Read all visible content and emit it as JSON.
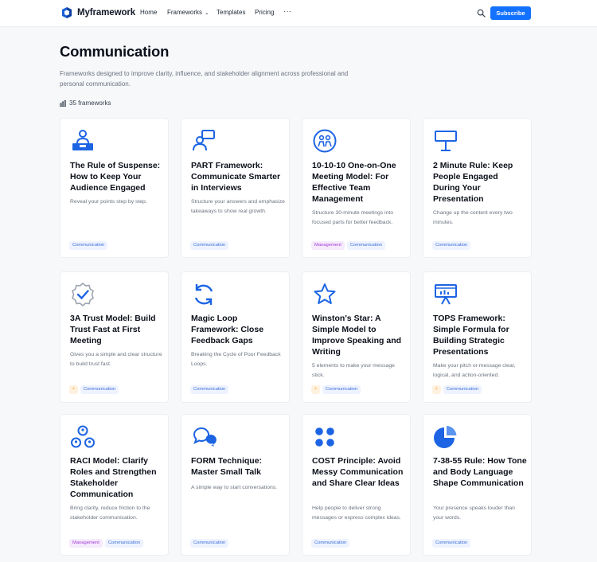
{
  "header": {
    "brand": "Myframework",
    "nav": [
      {
        "label": "Home"
      },
      {
        "label": "Frameworks",
        "has_dropdown": true
      },
      {
        "label": "Templates"
      },
      {
        "label": "Pricing"
      }
    ],
    "more": "···",
    "subscribe_label": "Subscribe",
    "accent_color": "#1371ff"
  },
  "page": {
    "title": "Communication",
    "description": "Frameworks designed to improve clarity, influence, and stakeholder alignment across professional and personal communication.",
    "count_label": "35 frameworks"
  },
  "cards": [
    {
      "icon": "presenter-at-podium-icon",
      "title": "The Rule of Suspense: How to Keep Your Audience Engaged",
      "description": "Reveal your points step by step.",
      "tags": [
        "Communication"
      ],
      "featured": false
    },
    {
      "icon": "interview-person-speech-icon",
      "title": "PART Framework: Communicate Smarter in Interviews",
      "description": "Structure your answers and emphasize takeaways to show real growth.",
      "tags": [
        "Communication"
      ],
      "featured": false
    },
    {
      "icon": "one-on-one-meeting-icon",
      "title": "10-10-10 One-on-One Meeting Model: For Effective Team Management",
      "description": "Structure 30-minute meetings into focused parts for better feedback.",
      "tags": [
        "Management",
        "Communication"
      ],
      "featured": false
    },
    {
      "icon": "podium-lamp-icon",
      "title": "2 Minute Rule: Keep People Engaged During Your Presentation",
      "description": "Change up the content every two minutes.",
      "tags": [
        "Communication"
      ],
      "featured": false
    },
    {
      "icon": "verified-badge-icon",
      "title": "3A Trust Model: Build Trust Fast at First Meeting",
      "description": "Gives you a simple and clear structure to build trust fast.",
      "tags": [
        "Communication"
      ],
      "featured": true
    },
    {
      "icon": "feedback-loop-icon",
      "title": "Magic Loop Framework: Close Feedback Gaps",
      "description": "Breaking the Cycle of Poor Feedback Loops.",
      "tags": [
        "Communication"
      ],
      "featured": false
    },
    {
      "icon": "star-outline-icon",
      "title": "Winston's Star: A Simple Model to Improve Speaking and Writing",
      "description": "5 elements to make your message stick.",
      "tags": [
        "Communication"
      ],
      "featured": true
    },
    {
      "icon": "presentation-board-icon",
      "title": "TOPS Framework: Simple Formula for Building Strategic Presentations",
      "description": "Make your pitch or message clear, logical, and action-oriented.",
      "tags": [
        "Communication"
      ],
      "featured": true
    },
    {
      "icon": "team-roles-icon",
      "title": "RACI Model: Clarify Roles and Strengthen Stakeholder Communication",
      "description": "Bring clarity, reduce friction to the stakeholder communication.",
      "tags": [
        "Management",
        "Communication"
      ],
      "featured": false
    },
    {
      "icon": "chat-bubbles-icon",
      "title": "FORM Technique: Master Small Talk",
      "description": "A simple way to start conversations.",
      "tags": [
        "Communication"
      ],
      "featured": false
    },
    {
      "icon": "four-dots-grid-icon",
      "title": "COST Principle: Avoid Messy Communication and Share Clear Ideas",
      "description": "Help people to deliver strong messages or express complex ideas.",
      "tags": [
        "Communication"
      ],
      "featured": false
    },
    {
      "icon": "pie-chart-icon",
      "title": "7-38-55 Rule: How Tone and Body Language Shape Communication",
      "description": "Your presence speaks louder than your words.",
      "tags": [
        "Communication"
      ],
      "featured": false
    }
  ]
}
